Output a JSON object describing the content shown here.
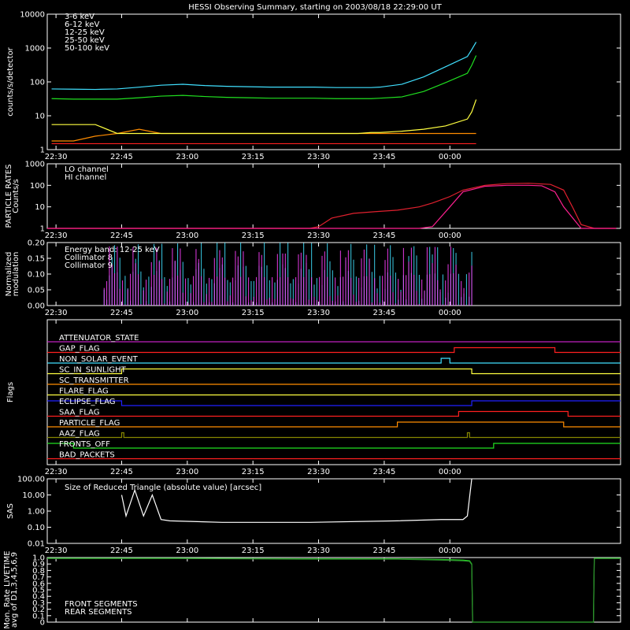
{
  "title": "HESSI Observing Summary, starting on 2003/08/18 22:29:00 UT",
  "chart_data": [
    {
      "id": "counts",
      "type": "line",
      "ylabel": "counts/s/detector",
      "yscale": "log",
      "ylim": [
        1,
        10000
      ],
      "yticks": [
        1,
        10,
        100,
        1000,
        10000
      ],
      "yticklabels": [
        "1",
        "10",
        "100",
        "1000",
        "10000"
      ],
      "xticklabels": [
        "22:30",
        "22:45",
        "23:00",
        "23:15",
        "23:30",
        "23:45",
        "00:00"
      ],
      "x_minutes": [
        0,
        5,
        10,
        15,
        20,
        25,
        30,
        35,
        40,
        45,
        50,
        55,
        60,
        65,
        70,
        73,
        75,
        80,
        85,
        90,
        95,
        96,
        97
      ],
      "series": [
        {
          "name": "3-6 keV",
          "color": "#ff2020",
          "values": [
            1.5,
            1.5,
            1.5,
            1.5,
            1.5,
            1.5,
            1.5,
            1.5,
            1.5,
            1.5,
            1.5,
            1.5,
            1.5,
            1.5,
            1.5,
            1.5,
            1.5,
            1.5,
            1.5,
            1.5,
            1.5,
            1.5,
            1.5
          ]
        },
        {
          "name": "6-12 keV",
          "color": "#ff8c00",
          "values": [
            1.8,
            1.8,
            2.5,
            3.0,
            4.0,
            3.0,
            3.0,
            3.0,
            3.0,
            3.0,
            3.0,
            3.0,
            3.0,
            3.0,
            3.0,
            3.0,
            3.0,
            3.0,
            3.0,
            3.0,
            3.0,
            3.0,
            3.0
          ]
        },
        {
          "name": "12-25 keV",
          "color": "#ffff40",
          "values": [
            5.5,
            5.5,
            5.5,
            3.0,
            3.0,
            3.0,
            3.0,
            3.0,
            3.0,
            3.0,
            3.0,
            3.0,
            3.0,
            3.0,
            3.0,
            3.2,
            3.2,
            3.5,
            4.0,
            5.0,
            8.0,
            13.0,
            30.0
          ]
        },
        {
          "name": "25-50 keV",
          "color": "#20e020",
          "values": [
            32,
            31,
            31,
            31,
            34,
            38,
            40,
            37,
            35,
            34,
            33,
            33,
            33,
            32,
            32,
            32,
            33,
            36,
            52,
            95,
            180,
            310,
            600
          ]
        },
        {
          "name": "50-100 keV",
          "color": "#40e0ff",
          "values": [
            62,
            61,
            60,
            62,
            70,
            80,
            85,
            78,
            74,
            72,
            70,
            70,
            70,
            68,
            68,
            68,
            70,
            85,
            140,
            280,
            560,
            900,
            1500
          ]
        }
      ]
    },
    {
      "id": "particle",
      "type": "line",
      "ylabel": "PARTICLE RATES Counts/s",
      "yscale": "log",
      "ylim": [
        1,
        1000
      ],
      "yticks": [
        1,
        10,
        100,
        1000
      ],
      "yticklabels": [
        "1",
        "10",
        "100",
        "1000"
      ],
      "xticklabels": [
        "22:30",
        "22:45",
        "23:00",
        "23:15",
        "23:30",
        "23:45",
        "00:00"
      ],
      "series": [
        {
          "name": "LO channel",
          "color": "#e0202e",
          "x_minutes": [
            0,
            60,
            62,
            65,
            70,
            75,
            80,
            85,
            88,
            92,
            95,
            100,
            105,
            110,
            115,
            118,
            120,
            122,
            125,
            130
          ],
          "values": [
            1,
            1,
            1.2,
            3,
            5,
            6,
            7,
            10,
            15,
            30,
            60,
            100,
            120,
            125,
            110,
            60,
            10,
            1.5,
            1,
            1
          ]
        },
        {
          "name": "HI channel",
          "color": "#ff2090",
          "x_minutes": [
            0,
            80,
            85,
            88,
            92,
            95,
            100,
            105,
            110,
            113,
            116,
            118,
            122,
            130
          ],
          "values": [
            1,
            1,
            1,
            1.2,
            10,
            50,
            90,
            100,
            100,
            95,
            50,
            10,
            1,
            1
          ]
        }
      ]
    },
    {
      "id": "modulation",
      "type": "line",
      "ylabel": "Normalized modulation",
      "ylim": [
        0,
        0.2
      ],
      "yticks": [
        0,
        0.05,
        0.1,
        0.15,
        0.2
      ],
      "yticklabels": [
        "0.00",
        "0.05",
        "0.10",
        "0.15",
        "0.20"
      ],
      "xticklabels": [
        "22:30",
        "22:45",
        "23:00",
        "23:15",
        "23:30",
        "23:45",
        "00:00"
      ],
      "energy_band": "Energy band: 12-25 keV",
      "active_range_minutes": [
        13,
        97
      ],
      "series": [
        {
          "name": "Collimator 8",
          "color": "#40e0ff",
          "typical_value": 0.1
        },
        {
          "name": "Collimator 9",
          "color": "#ff40ff",
          "typical_value": 0.09
        }
      ]
    },
    {
      "id": "flags",
      "type": "line",
      "ylabel": "Flags",
      "xticklabels": [
        "22:30",
        "22:45",
        "23:00",
        "23:15",
        "23:30",
        "23:45",
        "00:00"
      ],
      "series": [
        {
          "name": "ATTENUATOR_STATE",
          "color": "#c020c0",
          "segments": [
            [
              0,
              0,
              131
            ]
          ]
        },
        {
          "name": "GAP_FLAG",
          "color": "#ff2020",
          "segments": [
            [
              0,
              0,
              93
            ],
            [
              1,
              93,
              116
            ],
            [
              0,
              116,
              131
            ]
          ]
        },
        {
          "name": "NON_SOLAR_EVENT",
          "color": "#40e0ff",
          "segments": [
            [
              0,
              0,
              90
            ],
            [
              1,
              90,
              92
            ],
            [
              0,
              92,
              131
            ]
          ]
        },
        {
          "name": "SC_IN_SUNLIGHT",
          "color": "#ffff40",
          "segments": [
            [
              0,
              0,
              17
            ],
            [
              1,
              17,
              97
            ],
            [
              0,
              97,
              131
            ]
          ]
        },
        {
          "name": "SC_TRANSMITTER",
          "color": "#ff8c00",
          "segments": [
            [
              0,
              0,
              131
            ]
          ]
        },
        {
          "name": "FLARE_FLAG",
          "color": "#ffff40",
          "segments": [
            [
              0,
              0,
              131
            ]
          ]
        },
        {
          "name": "ECLIPSE_FLAG",
          "color": "#2020ff",
          "segments": [
            [
              1,
              0,
              17
            ],
            [
              0,
              17,
              97
            ],
            [
              1,
              97,
              131
            ]
          ]
        },
        {
          "name": "SAA_FLAG",
          "color": "#ff2020",
          "segments": [
            [
              0,
              0,
              94
            ],
            [
              1,
              94,
              119
            ],
            [
              0,
              119,
              131
            ]
          ]
        },
        {
          "name": "PARTICLE_FLAG",
          "color": "#ff8c00",
          "segments": [
            [
              0,
              0,
              80
            ],
            [
              1,
              80,
              118
            ],
            [
              0,
              118,
              131
            ]
          ]
        },
        {
          "name": "AAZ_FLAG",
          "color": "#888800",
          "segments": [
            [
              0,
              0,
              17
            ],
            [
              1,
              17,
              17.5
            ],
            [
              0,
              17.5,
              96
            ],
            [
              1,
              96,
              96.5
            ],
            [
              0,
              96.5,
              131
            ]
          ]
        },
        {
          "name": "FRONTS_OFF",
          "color": "#20e020",
          "segments": [
            [
              1,
              0,
              6
            ],
            [
              0,
              6,
              102
            ],
            [
              1,
              102,
              131
            ]
          ]
        },
        {
          "name": "BAD_PACKETS",
          "color": "#ff2020",
          "segments": [
            [
              0,
              0,
              131
            ]
          ]
        }
      ]
    },
    {
      "id": "sas",
      "type": "line",
      "ylabel": "SAS",
      "yscale": "log",
      "ylim": [
        0.01,
        100
      ],
      "yticks": [
        0.01,
        0.1,
        1,
        10,
        100
      ],
      "yticklabels": [
        "0.01",
        "0.10",
        "1.00",
        "10.00",
        "100.00"
      ],
      "xticklabels": [
        "22:30",
        "22:45",
        "23:00",
        "23:15",
        "23:30",
        "23:45",
        "00:00"
      ],
      "annotation": "Size of Reduced Triangle (absolute value) [arcsec]",
      "series": [
        {
          "name": "",
          "color": "#ffffff",
          "x_minutes": [
            17,
            18,
            20,
            22,
            24,
            26,
            28,
            40,
            60,
            80,
            90,
            95,
            96,
            97
          ],
          "values": [
            10,
            0.5,
            20,
            0.5,
            10,
            0.3,
            0.25,
            0.2,
            0.2,
            0.25,
            0.3,
            0.3,
            0.5,
            100
          ]
        }
      ]
    },
    {
      "id": "livetime",
      "type": "line",
      "ylabel": "Mon. Rate LIVETIME avg of D1,3,4,5,6,9",
      "ylim": [
        0.0,
        1.0
      ],
      "yticks": [
        0,
        0.1,
        0.2,
        0.3,
        0.4,
        0.5,
        0.6,
        0.7,
        0.8,
        0.9,
        1.0
      ],
      "yticklabels": [
        "0",
        "0.1",
        "0.2",
        "0.3",
        "0.4",
        "0.5",
        "0.6",
        "0.7",
        "0.8",
        "0.9",
        "1.0"
      ],
      "xticklabels": [
        "22:30",
        "22:45",
        "23:00",
        "23:15",
        "23:30",
        "23:45",
        "00:00"
      ],
      "series": [
        {
          "name": "FRONT SEGMENTS",
          "color": "#20e020",
          "x_minutes": [
            0,
            30,
            60,
            80,
            90,
            95,
            96.5,
            97,
            97.2,
            124.8,
            125,
            131
          ],
          "values": [
            0.99,
            0.99,
            0.98,
            0.98,
            0.97,
            0.96,
            0.95,
            0.9,
            0.0,
            0.0,
            0.99,
            0.99
          ]
        },
        {
          "name": "REAR SEGMENTS",
          "color": "#2e8b2e",
          "x_minutes": [
            0,
            30,
            60,
            80,
            90,
            95,
            96.5,
            97,
            97.2,
            124.8,
            125,
            131
          ],
          "values": [
            0.985,
            0.985,
            0.975,
            0.975,
            0.96,
            0.95,
            0.94,
            0.89,
            0.0,
            0.0,
            0.985,
            0.985
          ]
        }
      ]
    }
  ]
}
